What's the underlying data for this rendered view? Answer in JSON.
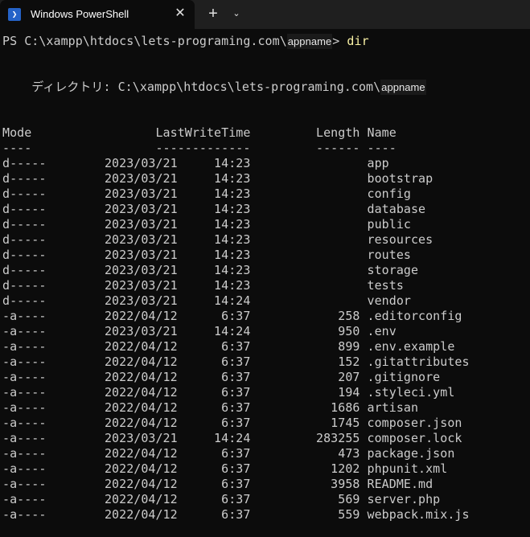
{
  "window": {
    "tab_title": "Windows PowerShell",
    "close_glyph": "✕",
    "new_tab_glyph": "+",
    "dropdown_glyph": "⌄"
  },
  "terminal": {
    "prompt": "PS C:\\xampp\\htdocs\\lets-programing.com\\",
    "prompt_masked": "appname",
    "prompt_suffix": ">",
    "command": "dir",
    "directory_label": "    ディレクトリ: C:\\xampp\\htdocs\\lets-programing.com\\",
    "directory_masked": "appname",
    "header_line": "Mode                 LastWriteTime         Length Name",
    "underline_line": "----                 -------------         ------ ----",
    "rows": [
      "d-----        2023/03/21     14:23                app",
      "d-----        2023/03/21     14:23                bootstrap",
      "d-----        2023/03/21     14:23                config",
      "d-----        2023/03/21     14:23                database",
      "d-----        2023/03/21     14:23                public",
      "d-----        2023/03/21     14:23                resources",
      "d-----        2023/03/21     14:23                routes",
      "d-----        2023/03/21     14:23                storage",
      "d-----        2023/03/21     14:23                tests",
      "d-----        2023/03/21     14:24                vendor",
      "-a----        2022/04/12      6:37            258 .editorconfig",
      "-a----        2023/03/21     14:24            950 .env",
      "-a----        2022/04/12      6:37            899 .env.example",
      "-a----        2022/04/12      6:37            152 .gitattributes",
      "-a----        2022/04/12      6:37            207 .gitignore",
      "-a----        2022/04/12      6:37            194 .styleci.yml",
      "-a----        2022/04/12      6:37           1686 artisan",
      "-a----        2022/04/12      6:37           1745 composer.json",
      "-a----        2023/03/21     14:24         283255 composer.lock",
      "-a----        2022/04/12      6:37            473 package.json",
      "-a----        2022/04/12      6:37           1202 phpunit.xml",
      "-a----        2022/04/12      6:37           3958 README.md",
      "-a----        2022/04/12      6:37            569 server.php",
      "-a----        2022/04/12      6:37            559 webpack.mix.js"
    ]
  },
  "colors": {
    "background": "#0c0c0c",
    "titlebar": "#1f1f1f",
    "text": "#cccccc",
    "command": "#f9f1a5",
    "ps_icon": "#2563c8"
  },
  "icons": {
    "app": "powershell-icon",
    "close": "close-icon",
    "new_tab": "plus-icon",
    "dropdown": "chevron-down-icon"
  }
}
